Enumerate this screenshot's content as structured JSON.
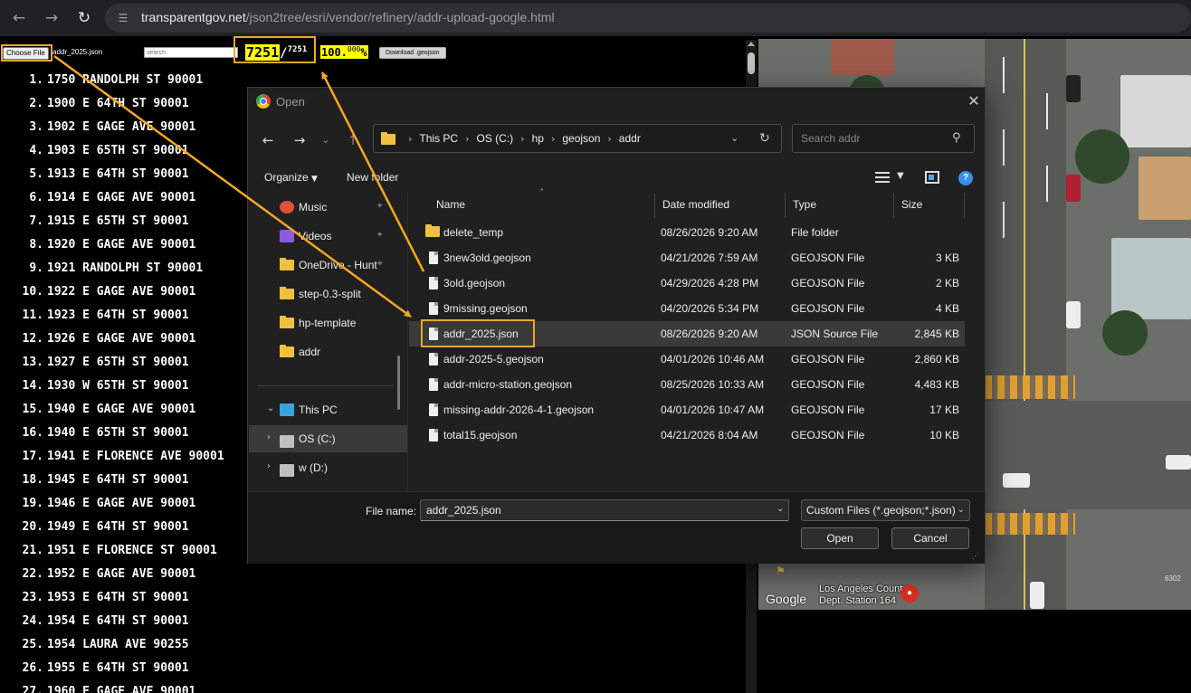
{
  "browser": {
    "url_host": "transparentgov.net",
    "url_path": "/json2tree/esri/vendor/refinery/addr-upload-google.html",
    "back_icon": "arrow-left-icon",
    "forward_icon": "arrow-right-icon",
    "reload_icon": "reload-icon",
    "site_info_icon": "tune-icon"
  },
  "page": {
    "choose_file_label": "Choose File",
    "chosen_file": "addr_2025.json",
    "search_placeholder": "search",
    "loaded_count": "7251",
    "total_count": "7251",
    "percent_main": "100.",
    "percent_decimal": "000",
    "percent_sign": "%",
    "download_label": "Download .geojson",
    "addresses": [
      {
        "n": "1.",
        "text": "1750 RANDOLPH ST 90001"
      },
      {
        "n": "2.",
        "text": "1900 E 64TH ST 90001"
      },
      {
        "n": "3.",
        "text": "1902 E GAGE AVE 90001"
      },
      {
        "n": "4.",
        "text": "1903 E 65TH ST 90001"
      },
      {
        "n": "5.",
        "text": "1913 E 64TH ST 90001"
      },
      {
        "n": "6.",
        "text": "1914 E GAGE AVE 90001"
      },
      {
        "n": "7.",
        "text": "1915 E 65TH ST 90001"
      },
      {
        "n": "8.",
        "text": "1920 E GAGE AVE 90001"
      },
      {
        "n": "9.",
        "text": "1921 RANDOLPH ST 90001"
      },
      {
        "n": "10.",
        "text": "1922 E GAGE AVE 90001"
      },
      {
        "n": "11.",
        "text": "1923 E 64TH ST 90001"
      },
      {
        "n": "12.",
        "text": "1926 E GAGE AVE 90001"
      },
      {
        "n": "13.",
        "text": "1927 E 65TH ST 90001"
      },
      {
        "n": "14.",
        "text": "1930 W 65TH ST 90001"
      },
      {
        "n": "15.",
        "text": "1940 E GAGE AVE 90001"
      },
      {
        "n": "16.",
        "text": "1940 E 65TH ST 90001"
      },
      {
        "n": "17.",
        "text": "1941 E FLORENCE AVE 90001"
      },
      {
        "n": "18.",
        "text": "1945 E 64TH ST 90001"
      },
      {
        "n": "19.",
        "text": "1946 E GAGE AVE 90001"
      },
      {
        "n": "20.",
        "text": "1949 E 64TH ST 90001"
      },
      {
        "n": "21.",
        "text": "1951 E FLORENCE ST 90001"
      },
      {
        "n": "22.",
        "text": "1952 E GAGE AVE 90001"
      },
      {
        "n": "23.",
        "text": "1953 E 64TH ST 90001"
      },
      {
        "n": "24.",
        "text": "1954 E 64TH ST 90001"
      },
      {
        "n": "25.",
        "text": "1954 LAURA AVE 90255"
      },
      {
        "n": "26.",
        "text": "1955 E 64TH ST 90001"
      },
      {
        "n": "27.",
        "text": "1960 E GAGE AVE 90001"
      }
    ]
  },
  "map": {
    "google_logo": "Google",
    "place_label_line1": "Los Angeles County",
    "place_label_line2": "Dept. Station 164",
    "corner_number": "6302"
  },
  "dialog": {
    "title": "Open",
    "close_icon": "close-icon",
    "breadcrumbs": [
      "This PC",
      "OS (C:)",
      "hp",
      "geojson",
      "addr"
    ],
    "search_placeholder": "Search addr",
    "organize_label": "Organize",
    "new_folder_label": "New folder",
    "nav_items": [
      {
        "label": "Music",
        "icon": "music-icon",
        "pinned": true
      },
      {
        "label": "Videos",
        "icon": "video-icon",
        "pinned": true
      },
      {
        "label": "OneDrive - Hunt",
        "icon": "folder-icon",
        "pinned": true
      },
      {
        "label": "step-0.3-split",
        "icon": "folder-icon",
        "pinned": false
      },
      {
        "label": "hp-template",
        "icon": "folder-icon",
        "pinned": false
      },
      {
        "label": "addr",
        "icon": "folder-icon",
        "pinned": false
      }
    ],
    "tree_items": [
      {
        "label": "This PC",
        "icon": "computer-icon",
        "expander": "chevron-down-icon"
      },
      {
        "label": "OS (C:)",
        "icon": "drive-icon",
        "expander": "chevron-right-icon",
        "selected": true
      },
      {
        "label": "w (D:)",
        "icon": "drive-icon",
        "expander": "chevron-right-icon"
      }
    ],
    "columns": [
      "Name",
      "Date modified",
      "Type",
      "Size"
    ],
    "files": [
      {
        "name": "delete_temp",
        "date": "08/26/2026 9:20 AM",
        "type": "File folder",
        "size": "",
        "kind": "folder"
      },
      {
        "name": "3new3old.geojson",
        "date": "04/21/2026 7:59 AM",
        "type": "GEOJSON File",
        "size": "3 KB",
        "kind": "file"
      },
      {
        "name": "3old.geojson",
        "date": "04/29/2026 4:28 PM",
        "type": "GEOJSON File",
        "size": "2 KB",
        "kind": "file"
      },
      {
        "name": "9missing.geojson",
        "date": "04/20/2026 5:34 PM",
        "type": "GEOJSON File",
        "size": "4 KB",
        "kind": "file"
      },
      {
        "name": "addr_2025.json",
        "date": "08/26/2026 9:20 AM",
        "type": "JSON Source File",
        "size": "2,845 KB",
        "kind": "file",
        "selected": true
      },
      {
        "name": "addr-2025-5.geojson",
        "date": "04/01/2026 10:46 AM",
        "type": "GEOJSON File",
        "size": "2,860 KB",
        "kind": "file"
      },
      {
        "name": "addr-micro-station.geojson",
        "date": "08/25/2026 10:33 AM",
        "type": "GEOJSON File",
        "size": "4,483 KB",
        "kind": "file"
      },
      {
        "name": "missing-addr-2026-4-1.geojson",
        "date": "04/01/2026 10:47 AM",
        "type": "GEOJSON File",
        "size": "17 KB",
        "kind": "file"
      },
      {
        "name": "total15.geojson",
        "date": "04/21/2026 8:04 AM",
        "type": "GEOJSON File",
        "size": "10 KB",
        "kind": "file"
      }
    ],
    "file_name_label": "File name:",
    "file_name_value": "addr_2025.json",
    "file_type_filter": "Custom Files (*.geojson;*.json)",
    "open_label": "Open",
    "cancel_label": "Cancel"
  },
  "annotation": {
    "highlight_color": "#f5a623",
    "counter_bg": "#ffff00"
  }
}
